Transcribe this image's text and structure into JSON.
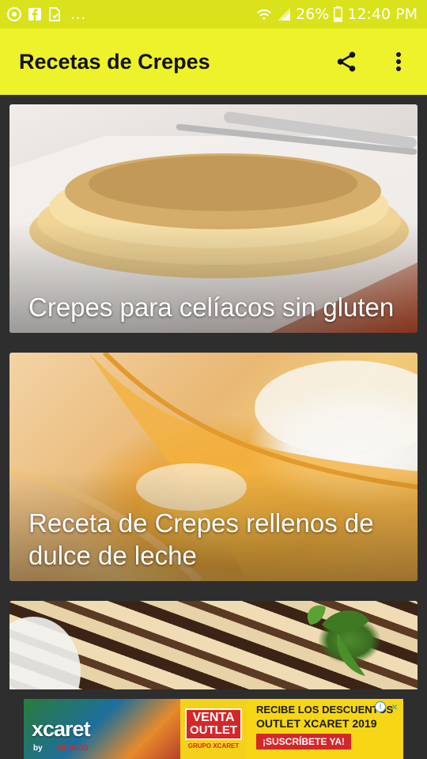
{
  "status_bar": {
    "battery": "26%",
    "time": "12:40 PM",
    "overflow": "...",
    "icons": [
      "messenger-icon",
      "facebook-icon",
      "document-icon",
      "wifi-icon",
      "signal-icon",
      "battery-icon"
    ]
  },
  "app_bar": {
    "title": "Recetas de Crepes",
    "icons": [
      "share-icon",
      "more-vert-icon"
    ]
  },
  "recipes": [
    {
      "title": "Crepes para celíacos sin gluten"
    },
    {
      "title": "Receta de Crepes rellenos de dulce de leche"
    },
    {
      "title": ""
    }
  ],
  "ad": {
    "brand": "xcaret",
    "brand_sub": "by",
    "brand_sub2": "MEXICO",
    "badge_line1": "VENTA",
    "badge_line2": "OUTLET",
    "badge_line3": "GRUPO XCARET",
    "headline_1": "RECIBE LOS DESCUENTOS",
    "headline_2": "OUTLET XCARET 2019",
    "cta": "¡SUSCRÍBETE YA!",
    "info": "i",
    "close": "×"
  },
  "colors": {
    "status_bar": "#d9e21a",
    "app_bar": "#eef22a",
    "background": "#2e2e2e",
    "card_text": "#ffffff"
  }
}
